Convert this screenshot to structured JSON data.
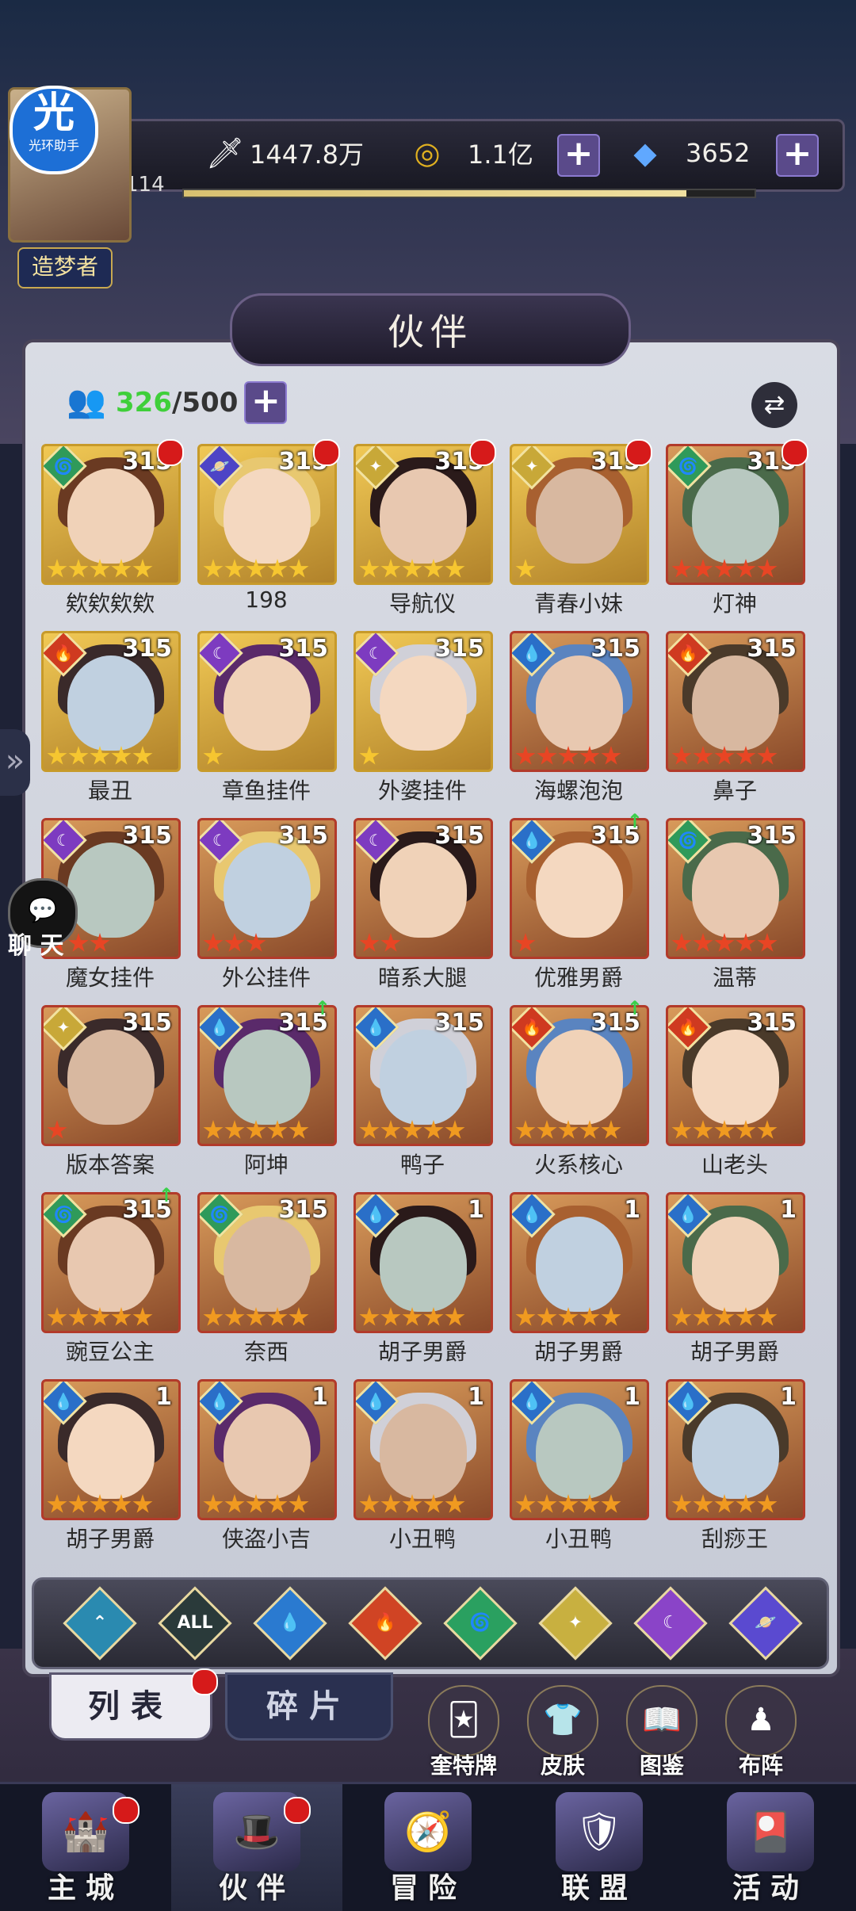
{
  "topbar": {
    "power": "1447.8万",
    "gold": "1.1亿",
    "gems": "3652",
    "level": "114",
    "xp_fraction": 0.88
  },
  "helper": {
    "big": "光",
    "small": "光环助手"
  },
  "player_title": "造梦者",
  "chat_label": "聊 天",
  "panel_title": "伙伴",
  "roster": {
    "current": "326",
    "max": "/500"
  },
  "cards": [
    {
      "name": "欸欸欸欸",
      "level": "315",
      "element": "wind",
      "stars": 5,
      "star_color": "g",
      "frame": "gold",
      "dot": true,
      "up": false
    },
    {
      "name": "198",
      "level": "315",
      "element": "space",
      "stars": 5,
      "star_color": "g",
      "frame": "gold",
      "dot": true,
      "up": false
    },
    {
      "name": "导航仪",
      "level": "315",
      "element": "light",
      "stars": 5,
      "star_color": "g",
      "frame": "gold",
      "dot": true,
      "up": false
    },
    {
      "name": "青春小妹",
      "level": "315",
      "element": "light",
      "stars": 1,
      "star_color": "g",
      "frame": "gold",
      "dot": true,
      "up": false
    },
    {
      "name": "灯神",
      "level": "315",
      "element": "wind",
      "stars": 5,
      "star_color": "r",
      "frame": "red",
      "dot": true,
      "up": false
    },
    {
      "name": "最丑",
      "level": "315",
      "element": "fire",
      "stars": 5,
      "star_color": "g",
      "frame": "gold",
      "dot": false,
      "up": false
    },
    {
      "name": "章鱼挂件",
      "level": "315",
      "element": "dark",
      "stars": 1,
      "star_color": "g",
      "frame": "gold",
      "dot": false,
      "up": false
    },
    {
      "name": "外婆挂件",
      "level": "315",
      "element": "dark",
      "stars": 1,
      "star_color": "g",
      "frame": "gold",
      "dot": false,
      "up": false
    },
    {
      "name": "海螺泡泡",
      "level": "315",
      "element": "water",
      "stars": 5,
      "star_color": "r",
      "frame": "red",
      "dot": false,
      "up": false
    },
    {
      "name": "鼻子",
      "level": "315",
      "element": "fire",
      "stars": 5,
      "star_color": "r",
      "frame": "red",
      "dot": false,
      "up": false
    },
    {
      "name": "魔女挂件",
      "level": "315",
      "element": "dark",
      "stars": 3,
      "star_color": "r",
      "frame": "red",
      "dot": false,
      "up": false
    },
    {
      "name": "外公挂件",
      "level": "315",
      "element": "dark",
      "stars": 3,
      "star_color": "r",
      "frame": "red",
      "dot": false,
      "up": false
    },
    {
      "name": "暗系大腿",
      "level": "315",
      "element": "dark",
      "stars": 2,
      "star_color": "r",
      "frame": "red",
      "dot": false,
      "up": false
    },
    {
      "name": "优雅男爵",
      "level": "315",
      "element": "water",
      "stars": 1,
      "star_color": "r",
      "frame": "red",
      "dot": false,
      "up": true
    },
    {
      "name": "温蒂",
      "level": "315",
      "element": "wind",
      "stars": 5,
      "star_color": "r",
      "frame": "red",
      "dot": false,
      "up": false
    },
    {
      "name": "版本答案",
      "level": "315",
      "element": "light",
      "stars": 1,
      "star_color": "r",
      "frame": "red",
      "dot": false,
      "up": false
    },
    {
      "name": "阿坤",
      "level": "315",
      "element": "water",
      "stars": 5,
      "star_color": "o",
      "frame": "red",
      "dot": false,
      "up": true
    },
    {
      "name": "鸭子",
      "level": "315",
      "element": "water",
      "stars": 5,
      "star_color": "o",
      "frame": "red",
      "dot": false,
      "up": false
    },
    {
      "name": "火系核心",
      "level": "315",
      "element": "fire",
      "stars": 5,
      "star_color": "o",
      "frame": "red",
      "dot": false,
      "up": true
    },
    {
      "name": "山老头",
      "level": "315",
      "element": "fire",
      "stars": 5,
      "star_color": "o",
      "frame": "red",
      "dot": false,
      "up": false
    },
    {
      "name": "豌豆公主",
      "level": "315",
      "element": "wind",
      "stars": 5,
      "star_color": "o",
      "frame": "red",
      "dot": false,
      "up": true
    },
    {
      "name": "奈西",
      "level": "315",
      "element": "wind",
      "stars": 5,
      "star_color": "o",
      "frame": "red",
      "dot": false,
      "up": false
    },
    {
      "name": "胡子男爵",
      "level": "1",
      "element": "water",
      "stars": 5,
      "star_color": "o",
      "frame": "red",
      "dot": false,
      "up": false
    },
    {
      "name": "胡子男爵",
      "level": "1",
      "element": "water",
      "stars": 5,
      "star_color": "o",
      "frame": "red",
      "dot": false,
      "up": false
    },
    {
      "name": "胡子男爵",
      "level": "1",
      "element": "water",
      "stars": 5,
      "star_color": "o",
      "frame": "red",
      "dot": false,
      "up": false
    },
    {
      "name": "胡子男爵",
      "level": "1",
      "element": "water",
      "stars": 5,
      "star_color": "o",
      "frame": "red",
      "dot": false,
      "up": false
    },
    {
      "name": "侠盗小吉",
      "level": "1",
      "element": "water",
      "stars": 5,
      "star_color": "o",
      "frame": "red",
      "dot": false,
      "up": false
    },
    {
      "name": "小丑鸭",
      "level": "1",
      "element": "water",
      "stars": 5,
      "star_color": "o",
      "frame": "red",
      "dot": false,
      "up": false
    },
    {
      "name": "小丑鸭",
      "level": "1",
      "element": "water",
      "stars": 5,
      "star_color": "o",
      "frame": "red",
      "dot": false,
      "up": false
    },
    {
      "name": "刮痧王",
      "level": "1",
      "element": "water",
      "stars": 5,
      "star_color": "o",
      "frame": "red",
      "dot": false,
      "up": false
    }
  ],
  "filters": [
    {
      "name": "chevron",
      "glyph": "⌃",
      "color": "#2a8ab0"
    },
    {
      "name": "all",
      "glyph": "ALL",
      "color": "#2a3a3a"
    },
    {
      "name": "water",
      "glyph": "💧",
      "color": "#2a7ad0"
    },
    {
      "name": "fire",
      "glyph": "🔥",
      "color": "#d04424"
    },
    {
      "name": "wind",
      "glyph": "🌀",
      "color": "#2aa060"
    },
    {
      "name": "light",
      "glyph": "✦",
      "color": "#c8b040"
    },
    {
      "name": "dark",
      "glyph": "☾",
      "color": "#8a44c8"
    },
    {
      "name": "space",
      "glyph": "🪐",
      "color": "#5a4ad0"
    }
  ],
  "tabs": {
    "list": "列表",
    "shards": "碎片"
  },
  "tools": [
    {
      "label": "奎特牌",
      "icon": "🃏"
    },
    {
      "label": "皮肤",
      "icon": "👕"
    },
    {
      "label": "图鉴",
      "icon": "📖"
    },
    {
      "label": "布阵",
      "icon": "♟"
    }
  ],
  "nav": [
    {
      "label": "主城",
      "icon": "🏰",
      "dot": true,
      "active": false
    },
    {
      "label": "伙伴",
      "icon": "🎩",
      "dot": true,
      "active": true
    },
    {
      "label": "冒险",
      "icon": "🧭",
      "dot": false,
      "active": false
    },
    {
      "label": "联盟",
      "icon": "🛡",
      "dot": false,
      "active": false
    },
    {
      "label": "活动",
      "icon": "🎴",
      "dot": false,
      "active": false
    }
  ],
  "element_colors": {
    "wind": "#2f9a5a",
    "space": "#4d44c6",
    "light": "#c8a838",
    "fire": "#cf3a20",
    "dark": "#7d3bc0",
    "water": "#2a6fc8"
  },
  "element_glyphs": {
    "wind": "🌀",
    "space": "🪐",
    "light": "✦",
    "fire": "🔥",
    "dark": "☾",
    "water": "💧"
  }
}
